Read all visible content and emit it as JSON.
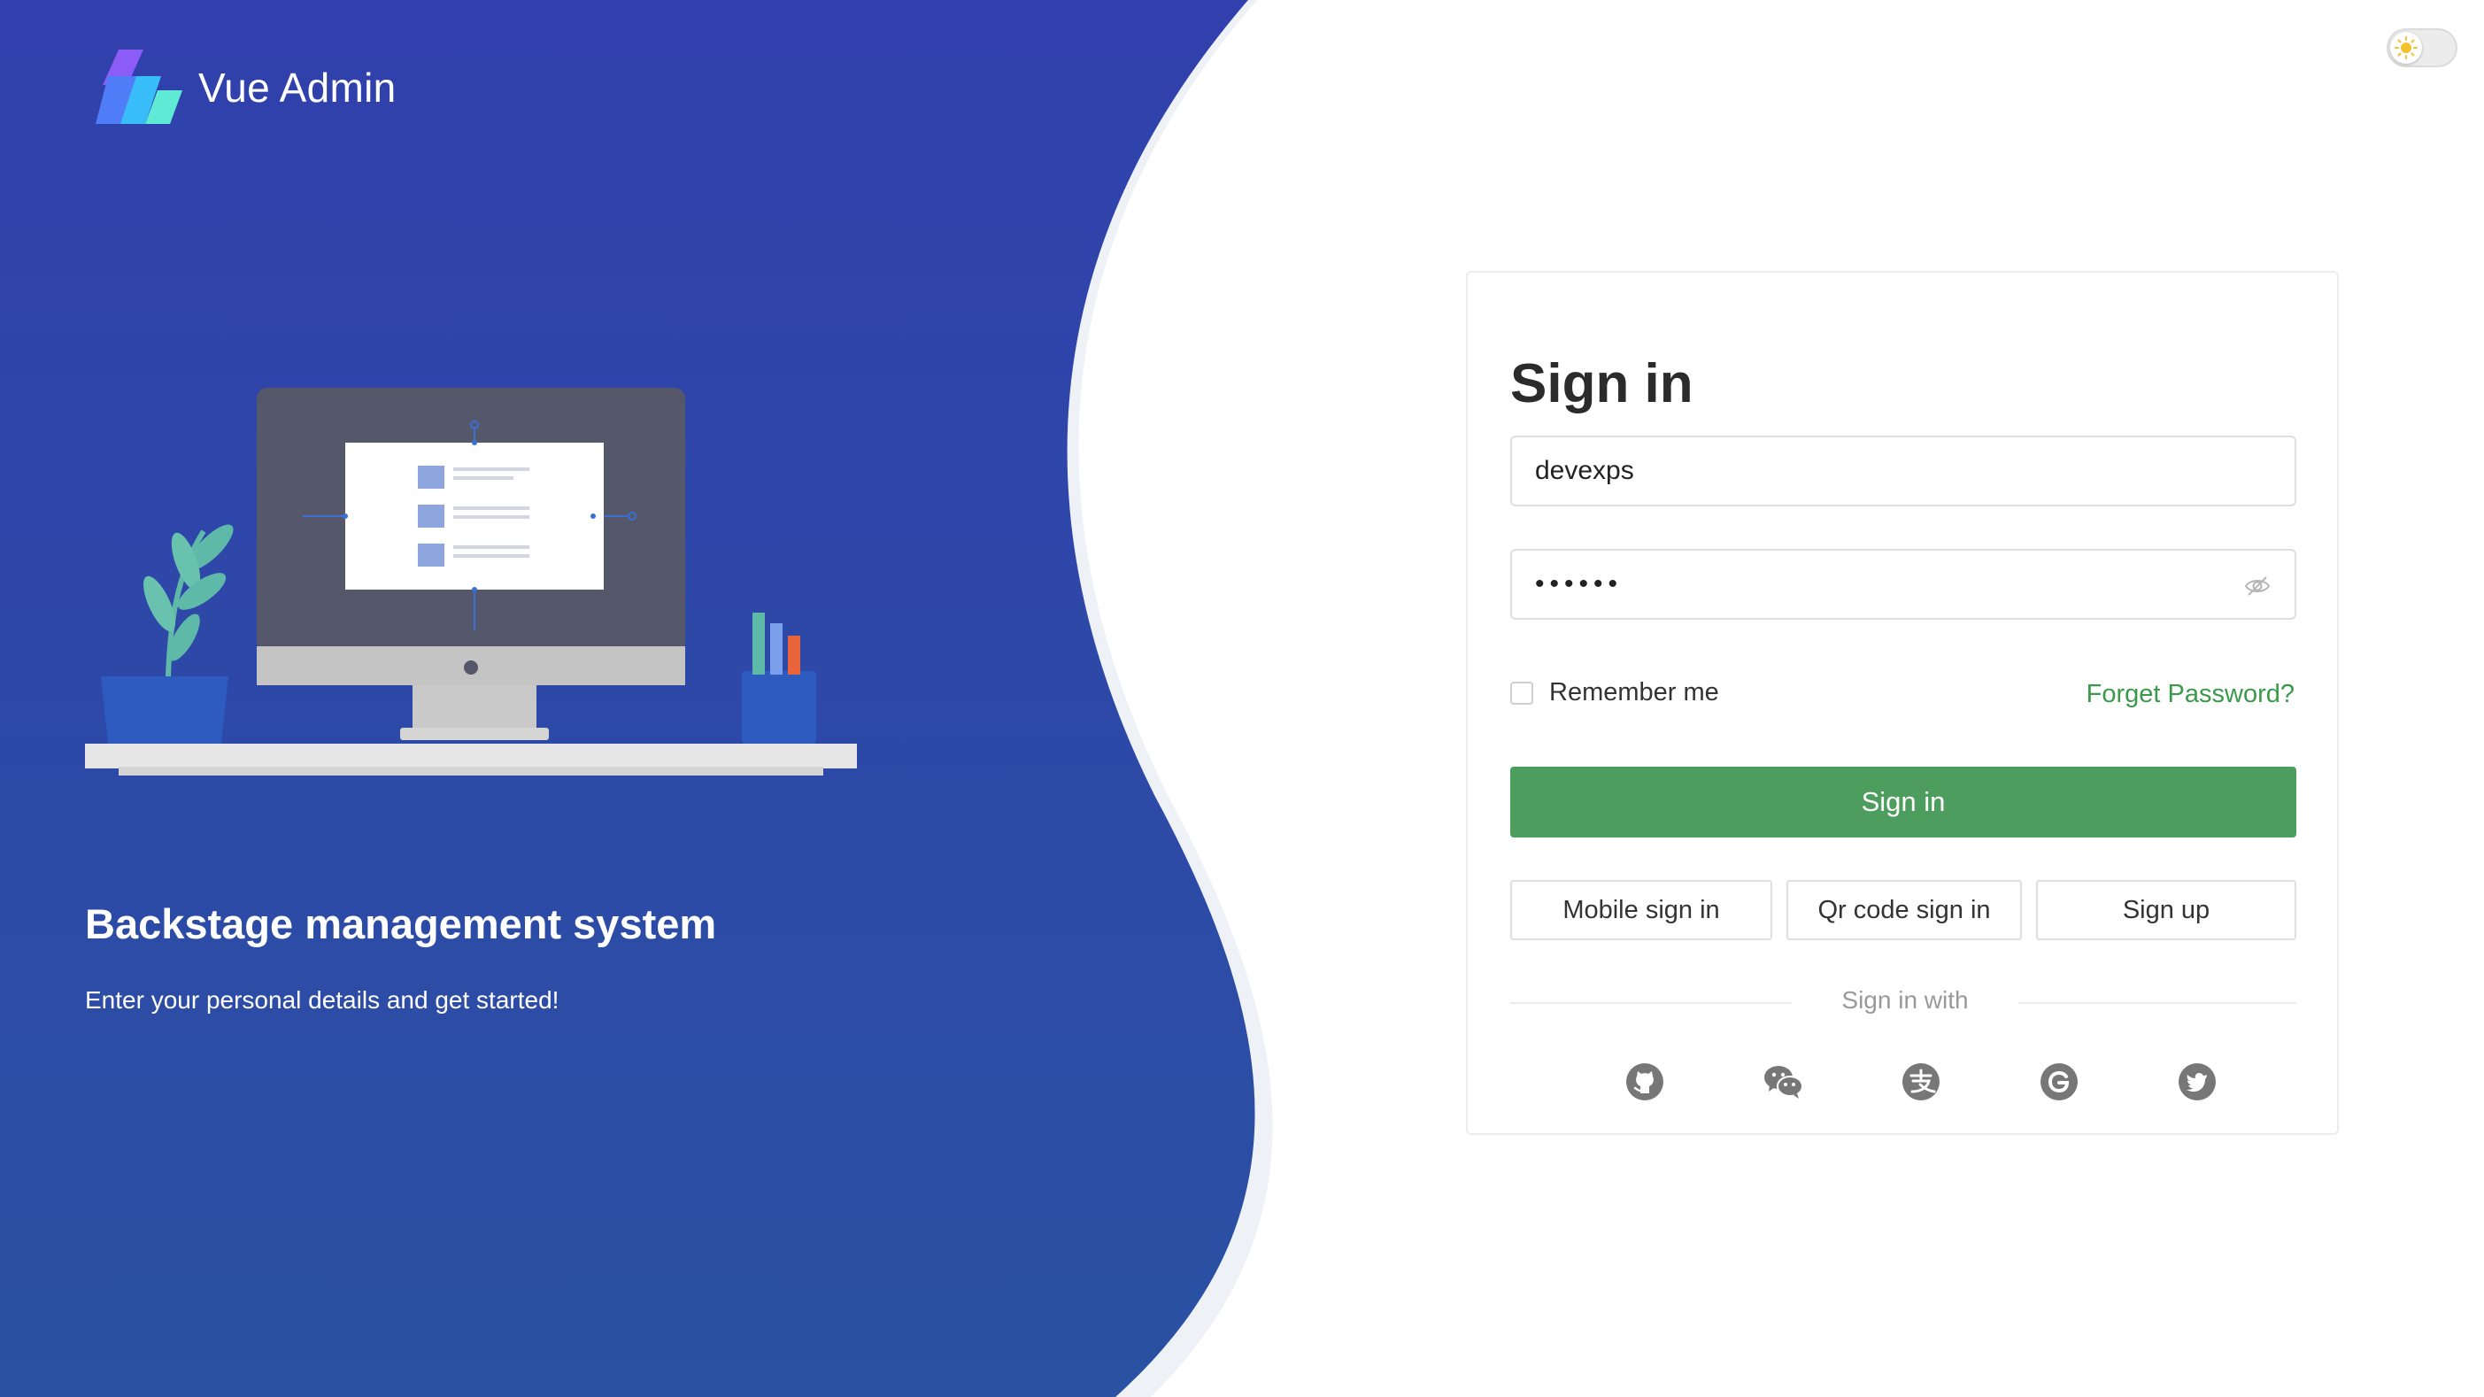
{
  "app": {
    "title": "Vue Admin"
  },
  "theme_toggle": {
    "icon": "sun-icon",
    "state": "light"
  },
  "hero": {
    "title": "Backstage management system",
    "subtitle": "Enter your personal details and get started!"
  },
  "form": {
    "title": "Sign in",
    "username": {
      "value": "devexps"
    },
    "password": {
      "value": "••••••",
      "visibility_icon": "eye-off-icon"
    },
    "remember_label": "Remember me",
    "remember_checked": false,
    "forgot_label": "Forget Password?",
    "submit_label": "Sign in",
    "alt_buttons": [
      "Mobile sign in",
      "Qr code sign in",
      "Sign up"
    ],
    "sign_in_with": "Sign in with",
    "social": [
      "github-icon",
      "wechat-icon",
      "alipay-icon",
      "google-icon",
      "twitter-icon"
    ]
  },
  "colors": {
    "panel_top": "#3140ad",
    "panel_bottom": "#2a4fa0",
    "primary": "#4d9e5e",
    "link": "#3a9a4a"
  }
}
